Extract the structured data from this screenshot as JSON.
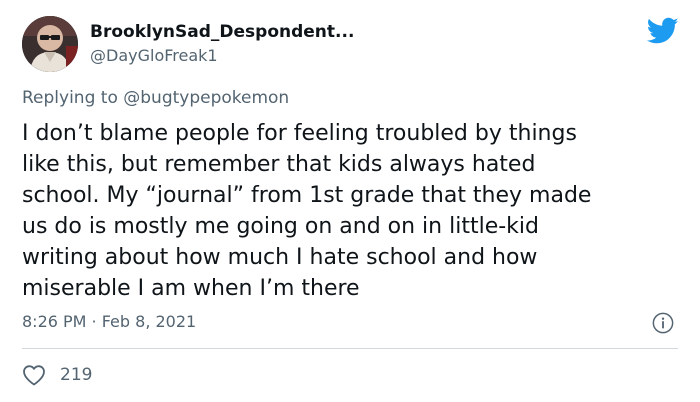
{
  "user": {
    "display_name": "BrooklynSad_Despondent...",
    "handle": "@DayGloFreak1"
  },
  "reply": {
    "prefix": "Replying to ",
    "mention": "@bugtypepokemon"
  },
  "tweet": {
    "text": "I don’t blame people for feeling troubled by things\nlike this, but remember that kids always hated\nschool. My “journal” from 1st grade that they made\nus do is mostly me going on and on in little-kid\nwriting about how much I hate school and how\nmiserable I am when I’m there",
    "timestamp": "8:26 PM · Feb 8, 2021"
  },
  "engagement": {
    "likes": "219"
  },
  "icons": {
    "brand": "twitter-bird-icon",
    "info": "info-icon",
    "like": "heart-icon"
  },
  "colors": {
    "twitter_blue": "#1d9bf0",
    "secondary_text": "#536471",
    "primary_text": "#0f1419",
    "divider": "#cfd9de"
  }
}
